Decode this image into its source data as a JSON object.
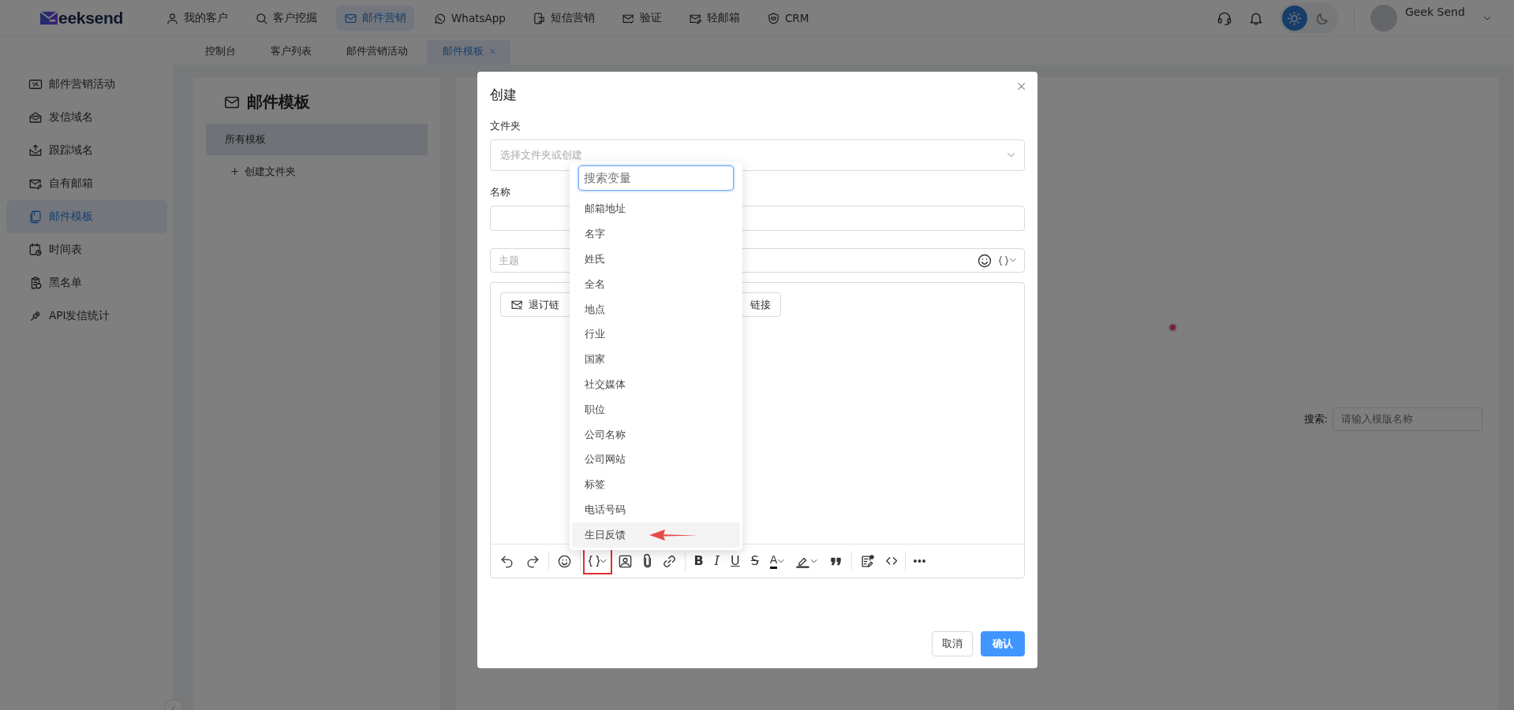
{
  "logo": {
    "text": "eeksend"
  },
  "nav": [
    {
      "label": "我的客户",
      "selected": false
    },
    {
      "label": "客户挖掘",
      "selected": false
    },
    {
      "label": "邮件营销",
      "selected": true
    },
    {
      "label": "WhatsApp",
      "selected": false
    },
    {
      "label": "短信营销",
      "selected": false
    },
    {
      "label": "验证",
      "selected": false
    },
    {
      "label": "轻邮箱",
      "selected": false
    },
    {
      "label": "CRM",
      "selected": false
    }
  ],
  "theme": {
    "dark_mode": false
  },
  "user": {
    "name": "Geek Send"
  },
  "tabs": [
    {
      "label": "控制台",
      "selected": false,
      "closable": false
    },
    {
      "label": "客户列表",
      "selected": false,
      "closable": false
    },
    {
      "label": "邮件营销活动",
      "selected": false,
      "closable": false
    },
    {
      "label": "邮件模板",
      "selected": true,
      "closable": true
    }
  ],
  "sidebar": {
    "items": [
      {
        "label": "邮件营销活动",
        "selected": false
      },
      {
        "label": "发信域名",
        "selected": false
      },
      {
        "label": "跟踪域名",
        "selected": false
      },
      {
        "label": "自有邮箱",
        "selected": false
      },
      {
        "label": "邮件模板",
        "selected": true
      },
      {
        "label": "时间表",
        "selected": false
      },
      {
        "label": "黑名单",
        "selected": false
      },
      {
        "label": "API发信统计",
        "selected": false
      }
    ]
  },
  "templates_panel": {
    "title": "邮件模板",
    "items": [
      {
        "label": "所有模板",
        "selected": true
      }
    ],
    "create_label": "创建文件夹"
  },
  "main": {
    "search": {
      "label": "搜索:",
      "placeholder": "请输入模版名称"
    }
  },
  "modal": {
    "title": "创建",
    "fields": [
      {
        "label": "文件夹",
        "kind": "select",
        "placeholder": "选择文件夹或创建"
      },
      {
        "label": "名称",
        "kind": "text"
      }
    ],
    "subject": {
      "placeholder": "主题"
    },
    "editor": {
      "buttons": [
        {
          "label": "退订链"
        },
        {
          "label": "链接"
        }
      ],
      "toolbar": [
        {
          "kind": "undo",
          "dropdown": false,
          "marked": false
        },
        {
          "kind": "redo",
          "dropdown": false,
          "marked": false
        },
        {
          "kind": "divider"
        },
        {
          "kind": "emoji",
          "dropdown": false,
          "marked": false
        },
        {
          "kind": "divider"
        },
        {
          "kind": "braces",
          "dropdown": true,
          "marked": true
        },
        {
          "kind": "image",
          "dropdown": false,
          "marked": false
        },
        {
          "kind": "attach",
          "dropdown": false,
          "marked": false
        },
        {
          "kind": "link",
          "dropdown": false,
          "marked": false
        },
        {
          "kind": "divider"
        },
        {
          "kind": "bold",
          "label": "B",
          "dropdown": false,
          "marked": false
        },
        {
          "kind": "italic",
          "label": "I",
          "dropdown": false,
          "marked": false
        },
        {
          "kind": "underline",
          "label": "U",
          "dropdown": false,
          "marked": false
        },
        {
          "kind": "strike",
          "label": "S",
          "dropdown": false,
          "marked": false
        },
        {
          "kind": "fontcolor",
          "label": "A",
          "dropdown": true,
          "marked": false
        },
        {
          "kind": "highlight",
          "dropdown": true,
          "marked": false
        },
        {
          "kind": "quote",
          "dropdown": false,
          "marked": false
        },
        {
          "kind": "divider"
        },
        {
          "kind": "template",
          "dropdown": false,
          "marked": false
        },
        {
          "kind": "code",
          "dropdown": false,
          "marked": false
        },
        {
          "kind": "divider"
        },
        {
          "kind": "more",
          "dropdown": false,
          "marked": false
        }
      ]
    },
    "buttons": [
      {
        "label": "取消",
        "primary": false
      },
      {
        "label": "确认",
        "primary": true
      }
    ]
  },
  "variable_menu": {
    "placeholder": "搜索变量",
    "items": [
      {
        "label": "邮箱地址",
        "selected": false,
        "pointed": false
      },
      {
        "label": "名字",
        "selected": false,
        "pointed": false
      },
      {
        "label": "姓氏",
        "selected": false,
        "pointed": false
      },
      {
        "label": "全名",
        "selected": false,
        "pointed": false
      },
      {
        "label": "地点",
        "selected": false,
        "pointed": false
      },
      {
        "label": "行业",
        "selected": false,
        "pointed": false
      },
      {
        "label": "国家",
        "selected": false,
        "pointed": false
      },
      {
        "label": "社交媒体",
        "selected": false,
        "pointed": false
      },
      {
        "label": "职位",
        "selected": false,
        "pointed": false
      },
      {
        "label": "公司名称",
        "selected": false,
        "pointed": false
      },
      {
        "label": "公司网站",
        "selected": false,
        "pointed": false
      },
      {
        "label": "标签",
        "selected": false,
        "pointed": false
      },
      {
        "label": "电话号码",
        "selected": false,
        "pointed": false
      },
      {
        "label": "生日反馈",
        "selected": true,
        "pointed": true
      }
    ]
  }
}
